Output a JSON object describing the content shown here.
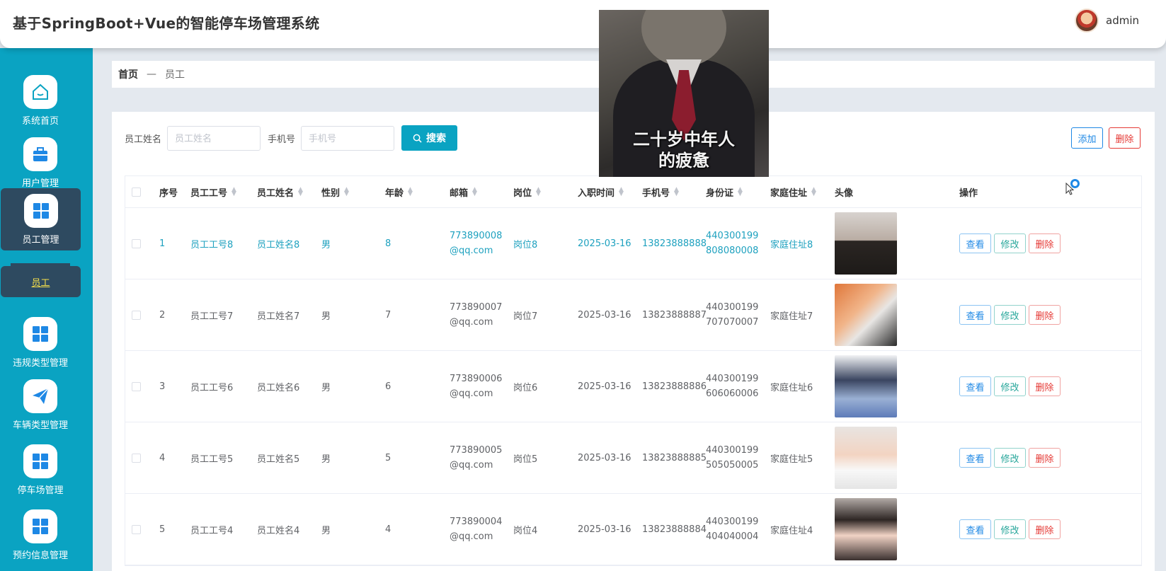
{
  "header": {
    "title": "基于SpringBoot+Vue的智能停车场管理系统",
    "username": "admin"
  },
  "sidebar": {
    "items": [
      {
        "label": "系统首页",
        "icon": "home-icon"
      },
      {
        "label": "用户管理",
        "icon": "briefcase-icon"
      },
      {
        "label": "员工管理",
        "icon": "grid-icon"
      },
      {
        "label": "违规类型管理",
        "icon": "grid-icon"
      },
      {
        "label": "车辆类型管理",
        "icon": "paper-plane-icon"
      },
      {
        "label": "停车场管理",
        "icon": "grid-icon"
      },
      {
        "label": "预约信息管理",
        "icon": "grid-icon"
      }
    ],
    "sub_item": "员工"
  },
  "breadcrumb": {
    "home": "首页",
    "sep": "—",
    "current": "员工"
  },
  "search": {
    "name_label": "员工姓名",
    "name_placeholder": "员工姓名",
    "phone_label": "手机号",
    "phone_placeholder": "手机号",
    "button": "搜索"
  },
  "actions": {
    "add": "添加",
    "delete": "删除"
  },
  "table": {
    "columns": [
      "序号",
      "员工工号",
      "员工姓名",
      "性别",
      "年龄",
      "邮箱",
      "岗位",
      "入职时间",
      "手机号",
      "身份证",
      "家庭住址",
      "头像",
      "操作"
    ],
    "rows": [
      {
        "no": "1",
        "code": "员工工号8",
        "name": "员工姓名8",
        "gender": "男",
        "age": "8",
        "email": "773890008@qq.com",
        "post": "岗位8",
        "date": "2025-03-16",
        "phone": "13823888888",
        "id": "440300199808080008",
        "addr": "家庭住址8"
      },
      {
        "no": "2",
        "code": "员工工号7",
        "name": "员工姓名7",
        "gender": "男",
        "age": "7",
        "email": "773890007@qq.com",
        "post": "岗位7",
        "date": "2025-03-16",
        "phone": "13823888887",
        "id": "440300199707070007",
        "addr": "家庭住址7"
      },
      {
        "no": "3",
        "code": "员工工号6",
        "name": "员工姓名6",
        "gender": "男",
        "age": "6",
        "email": "773890006@qq.com",
        "post": "岗位6",
        "date": "2025-03-16",
        "phone": "13823888886",
        "id": "440300199606060006",
        "addr": "家庭住址6"
      },
      {
        "no": "4",
        "code": "员工工号5",
        "name": "员工姓名5",
        "gender": "男",
        "age": "5",
        "email": "773890005@qq.com",
        "post": "岗位5",
        "date": "2025-03-16",
        "phone": "13823888885",
        "id": "440300199505050005",
        "addr": "家庭住址5"
      },
      {
        "no": "5",
        "code": "员工工号4",
        "name": "员工姓名4",
        "gender": "男",
        "age": "4",
        "email": "773890004@qq.com",
        "post": "岗位4",
        "date": "2025-03-16",
        "phone": "13823888884",
        "id": "440300199404040004",
        "addr": "家庭住址4"
      }
    ],
    "ops": {
      "view": "查看",
      "edit": "修改",
      "delete": "删除"
    }
  },
  "overlay": {
    "caption_line1": "二十岁中年人",
    "caption_line2": "的疲惫"
  },
  "colors": {
    "sidebar": "#0aa3c2",
    "active": "#2e4a60",
    "accent": "#1ea1bf",
    "danger": "#e53935"
  }
}
